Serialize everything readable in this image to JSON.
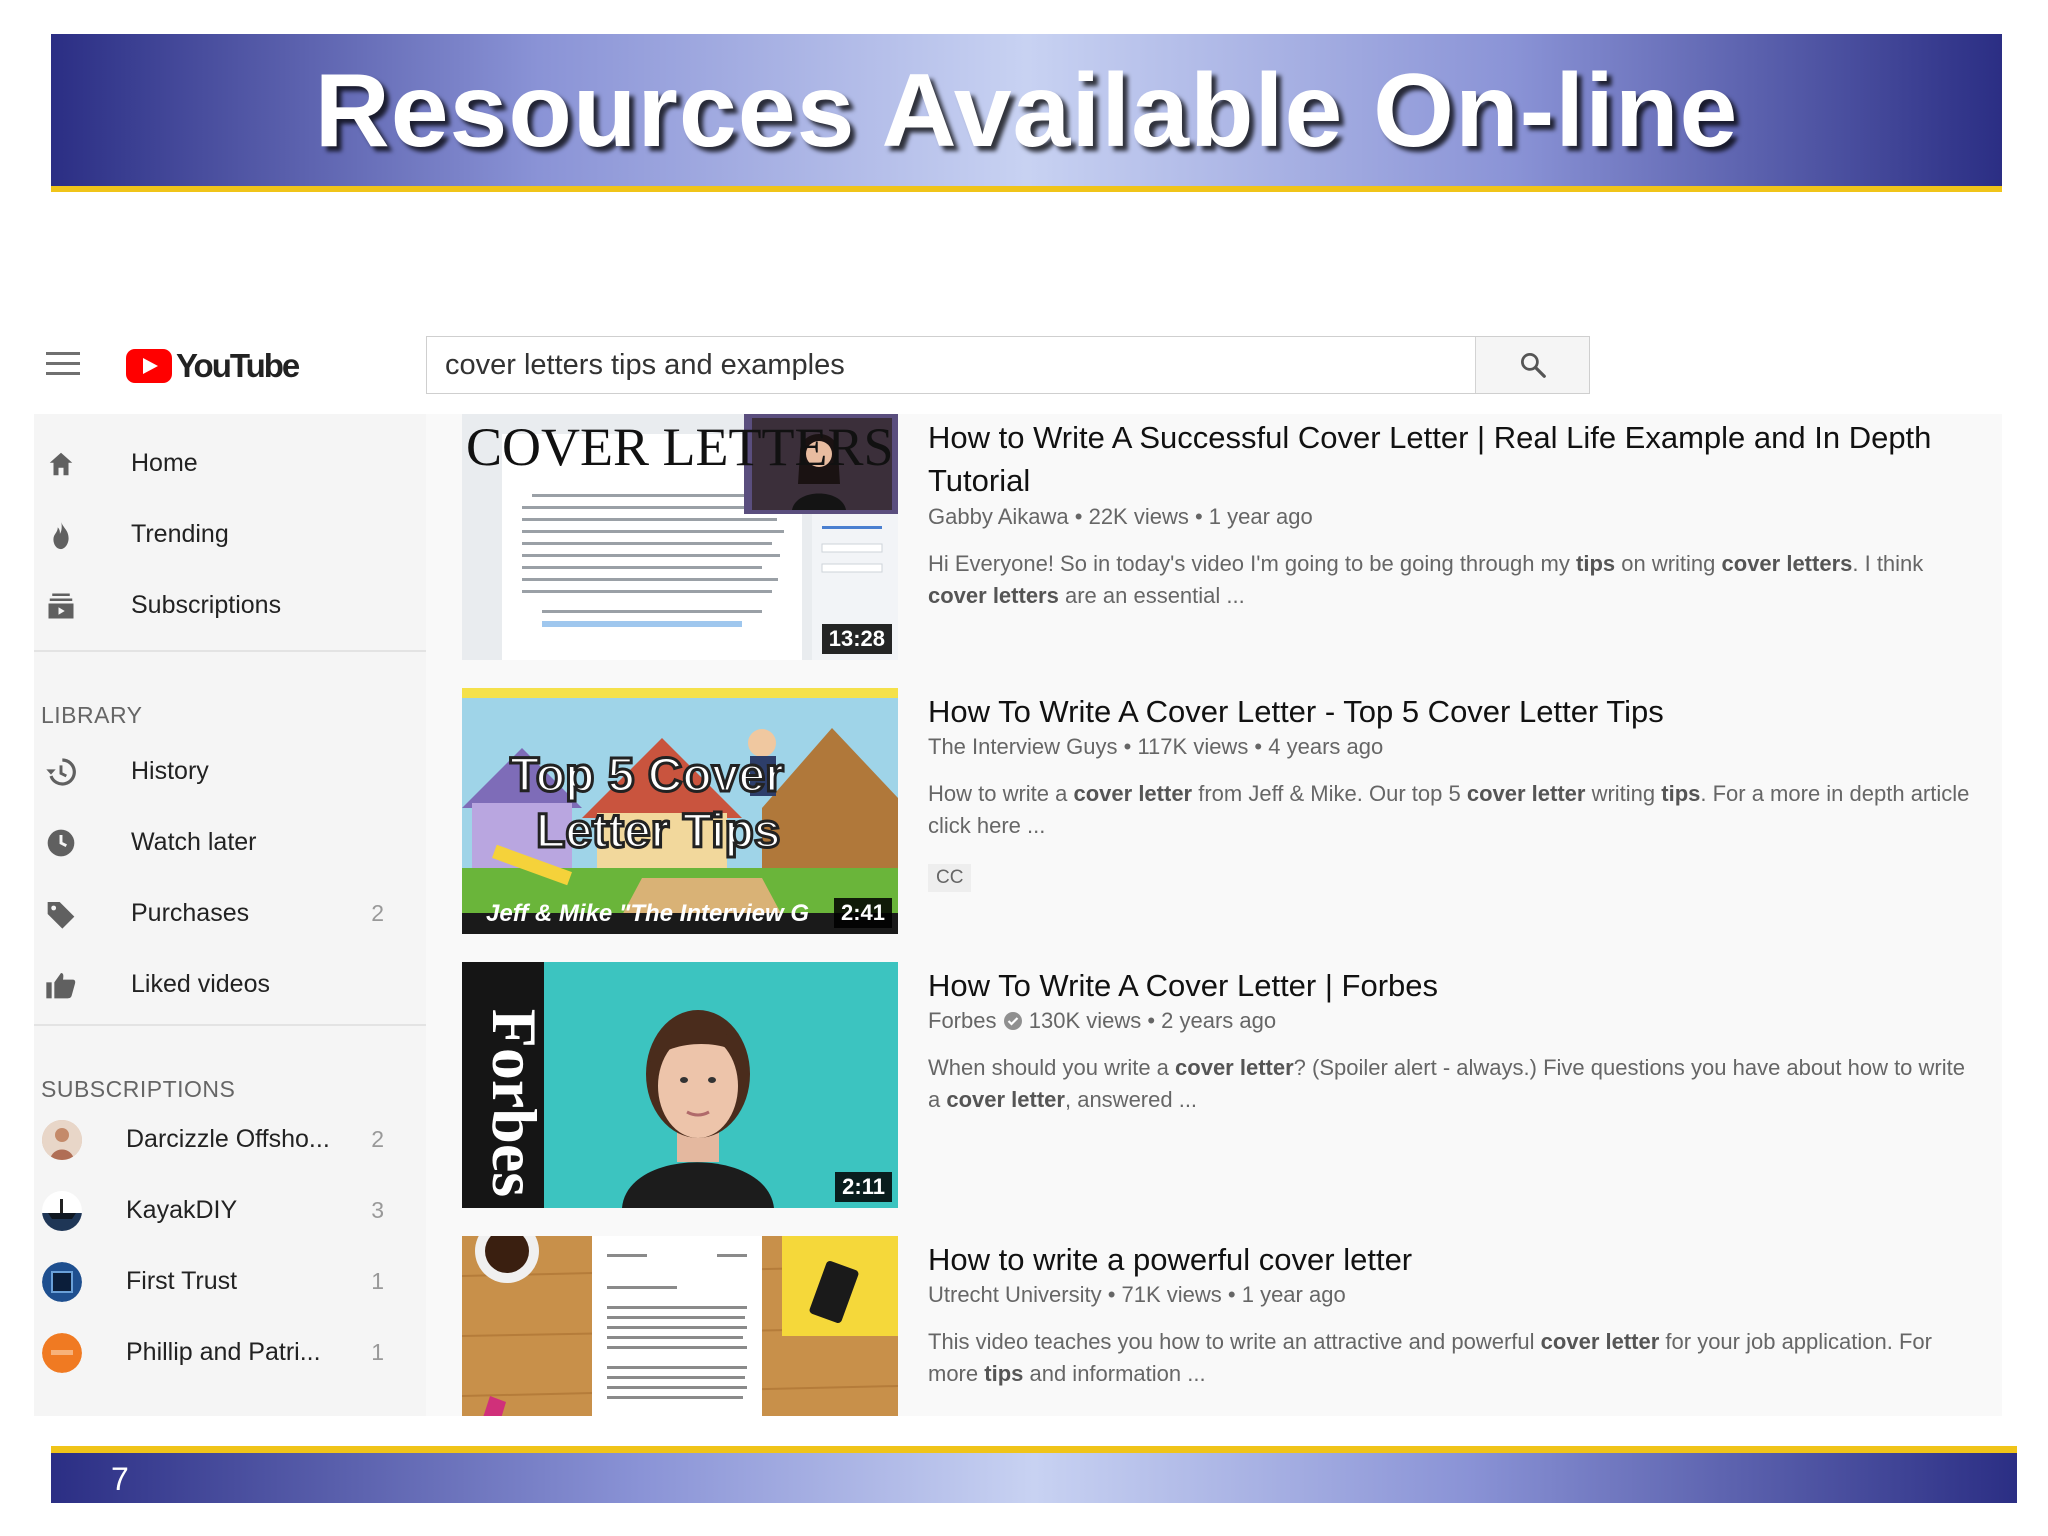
{
  "slide": {
    "title": "Resources Available On-line",
    "page_number": "7"
  },
  "youtube": {
    "logo_text": "YouTube",
    "search": {
      "query": "cover letters tips and examples"
    },
    "sidebar": {
      "main": [
        {
          "label": "Home",
          "icon": "home-icon"
        },
        {
          "label": "Trending",
          "icon": "flame-icon"
        },
        {
          "label": "Subscriptions",
          "icon": "subscriptions-icon"
        }
      ],
      "library_title": "LIBRARY",
      "library": [
        {
          "label": "History",
          "icon": "history-icon",
          "count": ""
        },
        {
          "label": "Watch later",
          "icon": "clock-icon",
          "count": ""
        },
        {
          "label": "Purchases",
          "icon": "tag-icon",
          "count": "2"
        },
        {
          "label": "Liked videos",
          "icon": "thumbs-up-icon",
          "count": ""
        }
      ],
      "subscriptions_title": "SUBSCRIPTIONS",
      "subscriptions": [
        {
          "label": "Darcizzle Offsho...",
          "count": "2",
          "color": "#d9b8a0"
        },
        {
          "label": "KayakDIY",
          "count": "3",
          "color": "#2a3c5a"
        },
        {
          "label": "First Trust",
          "count": "1",
          "color": "#1e4f8f"
        },
        {
          "label": "Phillip and Patri...",
          "count": "1",
          "color": "#f07a22"
        }
      ]
    },
    "results": [
      {
        "title": "How to Write A Successful Cover Letter | Real Life Example and In Depth Tutorial",
        "channel": "Gabby Aikawa",
        "meta": "22K views • 1 year ago",
        "desc_parts": [
          [
            "Hi Everyone! So in today's video I'm going to be going through my ",
            false
          ],
          [
            "tips",
            true
          ],
          [
            " on writing ",
            false
          ],
          [
            "cover letters",
            true
          ],
          [
            ". I think ",
            false
          ],
          [
            "cover letters",
            true
          ],
          [
            " are an essential ...",
            false
          ]
        ],
        "duration": "13:28",
        "thumb_text": "COVER LETTERS"
      },
      {
        "title": "How To Write A Cover Letter - Top 5 Cover Letter Tips",
        "channel": "The Interview Guys",
        "meta": "117K views • 4 years ago",
        "desc_parts": [
          [
            "How to write a ",
            false
          ],
          [
            "cover letter",
            true
          ],
          [
            " from Jeff & Mike. Our top 5 ",
            false
          ],
          [
            "cover letter",
            true
          ],
          [
            " writing ",
            false
          ],
          [
            "tips",
            true
          ],
          [
            ". For a more in depth article click here ...",
            false
          ]
        ],
        "badge": "CC",
        "duration": "2:41",
        "thumb_text_line1": "Top 5 Cover",
        "thumb_text_line2": "Letter Tips",
        "thumb_caption": "Jeff & Mike \"The Interview G"
      },
      {
        "title": "How To Write A Cover Letter | Forbes",
        "channel": "Forbes",
        "verified": true,
        "meta": "130K views • 2 years ago",
        "desc_parts": [
          [
            "When should you write a ",
            false
          ],
          [
            "cover letter",
            true
          ],
          [
            "? (Spoiler alert - always.) Five questions you have about how to write a ",
            false
          ],
          [
            "cover letter",
            true
          ],
          [
            ", answered ...",
            false
          ]
        ],
        "duration": "2:11",
        "thumb_text": "Forbes"
      },
      {
        "title": "How to write a powerful cover letter",
        "channel": "Utrecht University",
        "meta": "71K views • 1 year ago",
        "desc_parts": [
          [
            "This video teaches you how to write an attractive and powerful ",
            false
          ],
          [
            "cover letter",
            true
          ],
          [
            " for your job application. For more ",
            false
          ],
          [
            "tips",
            true
          ],
          [
            " and information ...",
            false
          ]
        ]
      }
    ]
  }
}
